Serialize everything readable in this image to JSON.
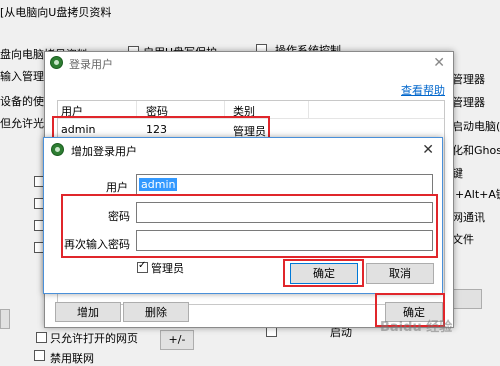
{
  "background": {
    "left_lines": [
      "[从电脑向U盘拷贝资料",
      "盘向电脑拷贝资料",
      "输入管理",
      "设备的使用",
      "但允许光"
    ],
    "copy_usb_label": "启用U盘写保护",
    "os_control_label": "操作系统控制",
    "right_lines": [
      "管理器",
      "管理器",
      "启动电脑(",
      "化和Ghost",
      "键",
      "l+Alt+A键",
      "网通讯",
      "文件"
    ],
    "allow_web_label": "只允许打开的网页",
    "plus_minus_label": "+/-",
    "bottom_partial_1": "禁用联网",
    "bottom_partial_2": "启动"
  },
  "login_dialog": {
    "title": "登录用户",
    "help_link": "查看帮助",
    "columns": [
      "用户",
      "密码",
      "类别"
    ],
    "rows": [
      {
        "user": "admin",
        "password": "123",
        "type": "管理员"
      }
    ],
    "add_button": "增加",
    "delete_button": "删除",
    "confirm_button": "确定"
  },
  "add_dialog": {
    "title": "增加登录用户",
    "user_label": "用户",
    "user_value": "admin",
    "password_label": "密码",
    "password_value": "",
    "confirm_label": "再次输入密码",
    "confirm_value": "",
    "admin_checkbox_label": "管理员",
    "admin_checked": true,
    "ok_button": "确定",
    "cancel_button": "取消"
  },
  "watermark": "Baidu 经验",
  "colors": {
    "highlight_red": "#e0262b",
    "link_blue": "#0066cc",
    "selection_blue": "#3399ff"
  }
}
